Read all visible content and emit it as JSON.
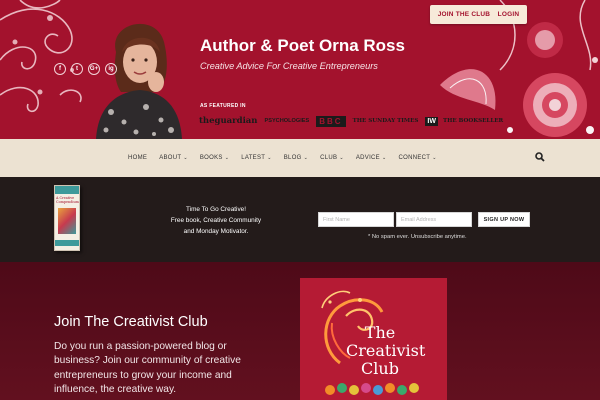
{
  "top_buttons": {
    "join": "JOIN THE CLUB",
    "login": "LOGIN"
  },
  "header": {
    "title": "Author & Poet Orna Ross",
    "tagline": "Creative Advice For Creative Entrepreneurs",
    "featured_label": "AS FEATURED IN",
    "logos": [
      "theguardian",
      "PSYCHOLOGIES",
      "BBC",
      "THE SUNDAY TIMES",
      "IW",
      "THE BOOKSELLER"
    ],
    "socials": [
      "f",
      "t",
      "G+",
      "ig"
    ]
  },
  "nav": {
    "items": [
      {
        "label": "HOME",
        "caret": false
      },
      {
        "label": "ABOUT",
        "caret": true
      },
      {
        "label": "BOOKS",
        "caret": true
      },
      {
        "label": "LATEST",
        "caret": true
      },
      {
        "label": "BLOG",
        "caret": true
      },
      {
        "label": "CLUB",
        "caret": true
      },
      {
        "label": "ADVICE",
        "caret": true
      },
      {
        "label": "CONNECT",
        "caret": true
      }
    ],
    "search_icon": "search-icon"
  },
  "signup": {
    "line1": "Time To Go Creative!",
    "line2": "Free book, Creative Community",
    "line3": "and Monday Motivator.",
    "first_name_placeholder": "First Name",
    "email_placeholder": "Email Address",
    "button": "SIGN UP NOW",
    "note": "* No spam ever. Unsubscribe anytime.",
    "book_title": "A Creative Compendium"
  },
  "club": {
    "title": "Join The Creativist Club",
    "description": "Do you run a passion-powered blog or business? Join our community of creative entrepreneurs to grow your income and influence, the creative way.",
    "image_title": "The Creativist Club"
  },
  "colors": {
    "brand": "#a3122d",
    "nav_bg": "#ece2d2",
    "signup_bg": "#231b1a",
    "club_bg": "#5a0d1c"
  }
}
